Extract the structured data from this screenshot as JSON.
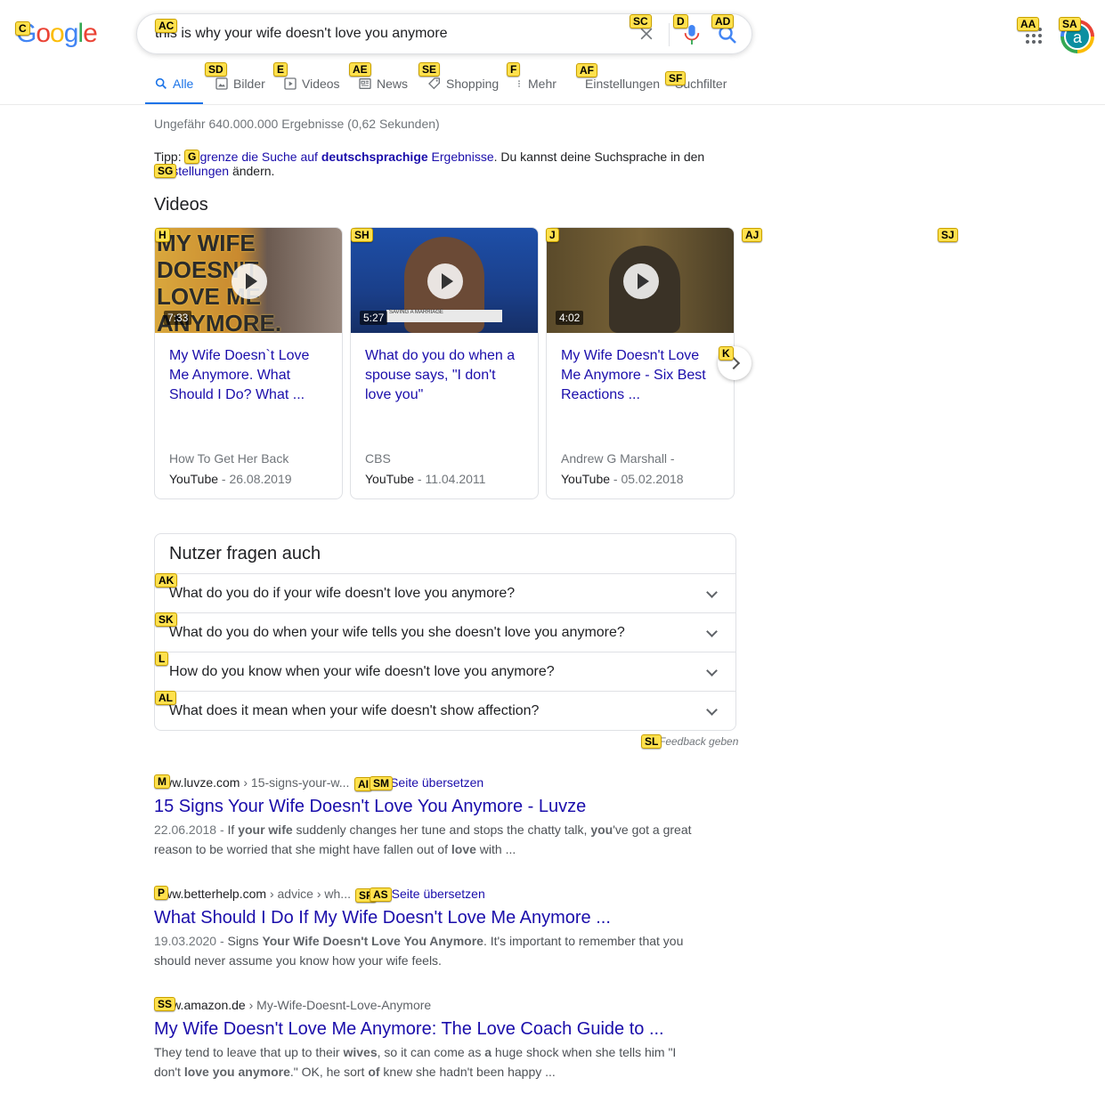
{
  "header": {
    "logo": "Google",
    "query": "this is why your wife doesn't love you anymore",
    "avatar_letter": "a"
  },
  "tabs": [
    {
      "label": "Alle",
      "icon": "search-icon",
      "active": true
    },
    {
      "label": "Bilder",
      "icon": "image-icon"
    },
    {
      "label": "Videos",
      "icon": "video-icon"
    },
    {
      "label": "News",
      "icon": "news-icon"
    },
    {
      "label": "Shopping",
      "icon": "tag-icon"
    },
    {
      "label": "Mehr",
      "icon": "more-vert-icon"
    },
    {
      "label": "Einstellungen"
    },
    {
      "label": "Suchfilter"
    }
  ],
  "stats": "Ungefähr 640.000.000 Ergebnisse (0,62 Sekunden)",
  "tipp": {
    "prefix": "Tipp: ",
    "link1": "Begrenze die Suche auf ",
    "bold": "deutschsprachige",
    "link1_end": " Ergebnisse",
    "middle": ". Du kannst deine Suchsprache in den ",
    "link2": "Einstellungen",
    "suffix": " ändern."
  },
  "videos": {
    "heading": "Videos",
    "items": [
      {
        "title": "My Wife Doesn`t Love Me Anymore. What Should I Do? What ...",
        "duration": "7:33",
        "source": "How To Get Her Back",
        "platform": "YouTube",
        "date": " - 26.08.2019",
        "thumb_text": "MY WIFE DOESN'T LOVE ME ANYMORE. HELP!"
      },
      {
        "title": "What do you do when a spouse says, \"I don't love you\"",
        "duration": "5:27",
        "source": "CBS",
        "platform": "YouTube",
        "date": " - 11.04.2011",
        "thumb_text": "SAVING A MARRIAGE"
      },
      {
        "title": "My Wife Doesn't Love Me Anymore - Six Best Reactions ...",
        "duration": "4:02",
        "source": "Andrew G Marshall -",
        "platform": "YouTube",
        "date": " - 05.02.2018"
      }
    ]
  },
  "paa": {
    "heading": "Nutzer fragen auch",
    "questions": [
      "What do you do if your wife doesn't love you anymore?",
      "What do you do when your wife tells you she doesn't love you anymore?",
      "How do you know when your wife doesn't love you anymore?",
      "What does it mean when your wife doesn't show affection?"
    ],
    "feedback": "Feedback geben"
  },
  "results": [
    {
      "domain": "www.luvze.com",
      "path": " › 15-signs-your-w...",
      "translate": "Diese Seite übersetzen",
      "title": "15 Signs Your Wife Doesn't Love You Anymore - Luvze",
      "date": "22.06.2018 - ",
      "snippet_html": "If <b>your wife</b> suddenly changes her tune and stops the chatty talk, <b>you</b>'ve got a great reason to be worried that she might have fallen out of <b>love</b> with ..."
    },
    {
      "domain": "www.betterhelp.com",
      "path": " › advice › wh...",
      "translate": "Diese Seite übersetzen",
      "title": "What Should I Do If My Wife Doesn't Love Me Anymore ...",
      "date": "19.03.2020 - ",
      "snippet_html": "Signs <b>Your Wife Doesn't Love You Anymore</b>. It's important to remember that you should never assume you know how your wife feels."
    },
    {
      "domain": "www.amazon.de",
      "path": " › My-Wife-Doesnt-Love-Anymore",
      "translate": "",
      "title": "My Wife Doesn't Love Me Anymore: The Love Coach Guide to ...",
      "date": "",
      "snippet_html": "They tend to leave that up to their <b>wives</b>, so it can come as <b>a</b> huge shock when she tells him \"I don't <b>love you anymore</b>.\" OK, he sort <b>of</b> knew she hadn't been happy ..."
    }
  ],
  "hints": {
    "C": "C",
    "AC": "AC",
    "SC": "SC",
    "D": "D",
    "AD": "AD",
    "AA": "AA",
    "SA": "SA",
    "SD": "SD",
    "E": "E",
    "AE": "AE",
    "SE": "SE",
    "F": "F",
    "AF": "AF",
    "SF": "SF",
    "G": "G",
    "SG": "SG",
    "H": "H",
    "SH": "SH",
    "J": "J",
    "AJ": "AJ",
    "SJ": "SJ",
    "K": "K",
    "AK": "AK",
    "SK": "SK",
    "L": "L",
    "AL": "AL",
    "SL": "SL",
    "M": "M",
    "AI": "AI",
    "SM": "SM",
    "P": "P",
    "SP": "SP",
    "AS": "AS",
    "SS": "SS"
  },
  "colors": {
    "link": "#1a0dab",
    "accent": "#1a73e8",
    "hint_bg": "#ffe14d"
  }
}
